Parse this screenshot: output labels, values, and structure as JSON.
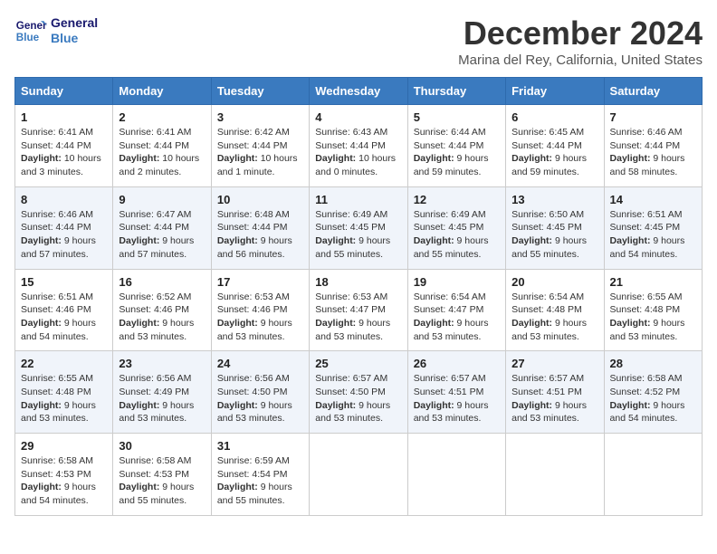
{
  "header": {
    "logo_line1": "General",
    "logo_line2": "Blue",
    "month": "December 2024",
    "location": "Marina del Rey, California, United States"
  },
  "weekdays": [
    "Sunday",
    "Monday",
    "Tuesday",
    "Wednesday",
    "Thursday",
    "Friday",
    "Saturday"
  ],
  "weeks": [
    [
      {
        "day": "1",
        "info": "Sunrise: 6:41 AM\nSunset: 4:44 PM\nDaylight: 10 hours\nand 3 minutes."
      },
      {
        "day": "2",
        "info": "Sunrise: 6:41 AM\nSunset: 4:44 PM\nDaylight: 10 hours\nand 2 minutes."
      },
      {
        "day": "3",
        "info": "Sunrise: 6:42 AM\nSunset: 4:44 PM\nDaylight: 10 hours\nand 1 minute."
      },
      {
        "day": "4",
        "info": "Sunrise: 6:43 AM\nSunset: 4:44 PM\nDaylight: 10 hours\nand 0 minutes."
      },
      {
        "day": "5",
        "info": "Sunrise: 6:44 AM\nSunset: 4:44 PM\nDaylight: 9 hours\nand 59 minutes."
      },
      {
        "day": "6",
        "info": "Sunrise: 6:45 AM\nSunset: 4:44 PM\nDaylight: 9 hours\nand 59 minutes."
      },
      {
        "day": "7",
        "info": "Sunrise: 6:46 AM\nSunset: 4:44 PM\nDaylight: 9 hours\nand 58 minutes."
      }
    ],
    [
      {
        "day": "8",
        "info": "Sunrise: 6:46 AM\nSunset: 4:44 PM\nDaylight: 9 hours\nand 57 minutes."
      },
      {
        "day": "9",
        "info": "Sunrise: 6:47 AM\nSunset: 4:44 PM\nDaylight: 9 hours\nand 57 minutes."
      },
      {
        "day": "10",
        "info": "Sunrise: 6:48 AM\nSunset: 4:44 PM\nDaylight: 9 hours\nand 56 minutes."
      },
      {
        "day": "11",
        "info": "Sunrise: 6:49 AM\nSunset: 4:45 PM\nDaylight: 9 hours\nand 55 minutes."
      },
      {
        "day": "12",
        "info": "Sunrise: 6:49 AM\nSunset: 4:45 PM\nDaylight: 9 hours\nand 55 minutes."
      },
      {
        "day": "13",
        "info": "Sunrise: 6:50 AM\nSunset: 4:45 PM\nDaylight: 9 hours\nand 55 minutes."
      },
      {
        "day": "14",
        "info": "Sunrise: 6:51 AM\nSunset: 4:45 PM\nDaylight: 9 hours\nand 54 minutes."
      }
    ],
    [
      {
        "day": "15",
        "info": "Sunrise: 6:51 AM\nSunset: 4:46 PM\nDaylight: 9 hours\nand 54 minutes."
      },
      {
        "day": "16",
        "info": "Sunrise: 6:52 AM\nSunset: 4:46 PM\nDaylight: 9 hours\nand 53 minutes."
      },
      {
        "day": "17",
        "info": "Sunrise: 6:53 AM\nSunset: 4:46 PM\nDaylight: 9 hours\nand 53 minutes."
      },
      {
        "day": "18",
        "info": "Sunrise: 6:53 AM\nSunset: 4:47 PM\nDaylight: 9 hours\nand 53 minutes."
      },
      {
        "day": "19",
        "info": "Sunrise: 6:54 AM\nSunset: 4:47 PM\nDaylight: 9 hours\nand 53 minutes."
      },
      {
        "day": "20",
        "info": "Sunrise: 6:54 AM\nSunset: 4:48 PM\nDaylight: 9 hours\nand 53 minutes."
      },
      {
        "day": "21",
        "info": "Sunrise: 6:55 AM\nSunset: 4:48 PM\nDaylight: 9 hours\nand 53 minutes."
      }
    ],
    [
      {
        "day": "22",
        "info": "Sunrise: 6:55 AM\nSunset: 4:48 PM\nDaylight: 9 hours\nand 53 minutes."
      },
      {
        "day": "23",
        "info": "Sunrise: 6:56 AM\nSunset: 4:49 PM\nDaylight: 9 hours\nand 53 minutes."
      },
      {
        "day": "24",
        "info": "Sunrise: 6:56 AM\nSunset: 4:50 PM\nDaylight: 9 hours\nand 53 minutes."
      },
      {
        "day": "25",
        "info": "Sunrise: 6:57 AM\nSunset: 4:50 PM\nDaylight: 9 hours\nand 53 minutes."
      },
      {
        "day": "26",
        "info": "Sunrise: 6:57 AM\nSunset: 4:51 PM\nDaylight: 9 hours\nand 53 minutes."
      },
      {
        "day": "27",
        "info": "Sunrise: 6:57 AM\nSunset: 4:51 PM\nDaylight: 9 hours\nand 53 minutes."
      },
      {
        "day": "28",
        "info": "Sunrise: 6:58 AM\nSunset: 4:52 PM\nDaylight: 9 hours\nand 54 minutes."
      }
    ],
    [
      {
        "day": "29",
        "info": "Sunrise: 6:58 AM\nSunset: 4:53 PM\nDaylight: 9 hours\nand 54 minutes."
      },
      {
        "day": "30",
        "info": "Sunrise: 6:58 AM\nSunset: 4:53 PM\nDaylight: 9 hours\nand 55 minutes."
      },
      {
        "day": "31",
        "info": "Sunrise: 6:59 AM\nSunset: 4:54 PM\nDaylight: 9 hours\nand 55 minutes."
      },
      null,
      null,
      null,
      null
    ]
  ]
}
